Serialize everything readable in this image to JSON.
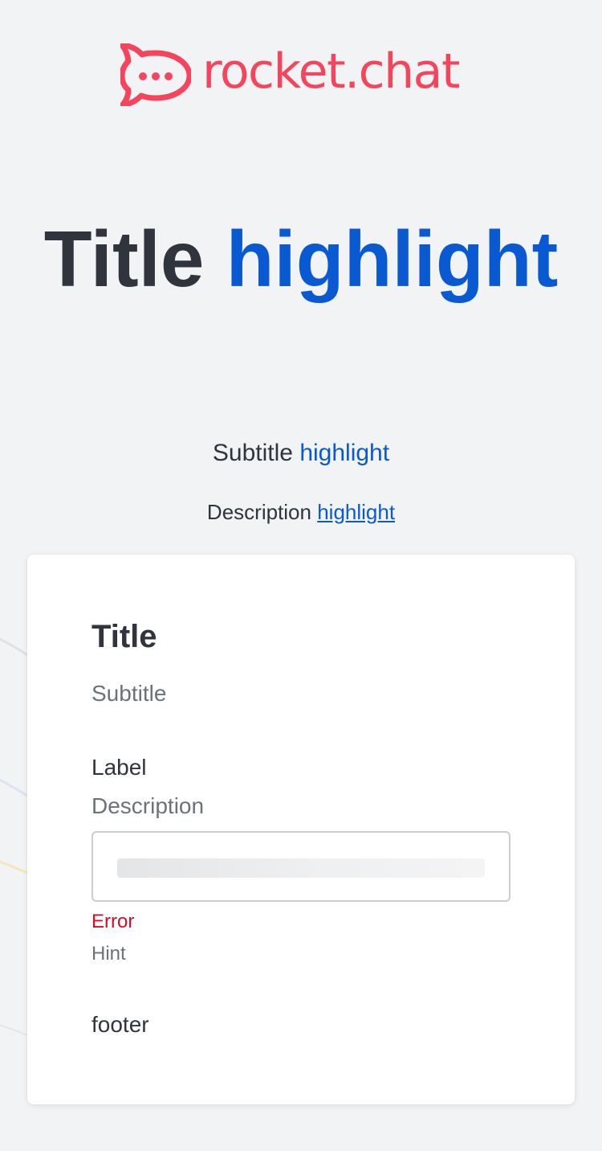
{
  "brand": {
    "logo_text": "rocket.chat",
    "color": "#f5455c"
  },
  "hero": {
    "title": "Title",
    "title_highlight": "highlight",
    "subtitle": "Subtitle",
    "subtitle_highlight": "highlight",
    "description": "Description",
    "description_link": "highlight",
    "highlight_color": "#095ad2"
  },
  "form_card": {
    "title": "Title",
    "subtitle": "Subtitle",
    "field": {
      "label": "Label",
      "description": "Description",
      "value": "",
      "state": "loading-skeleton",
      "error": "Error",
      "hint": "Hint"
    },
    "footer": "footer",
    "error_color": "#d40c26"
  }
}
